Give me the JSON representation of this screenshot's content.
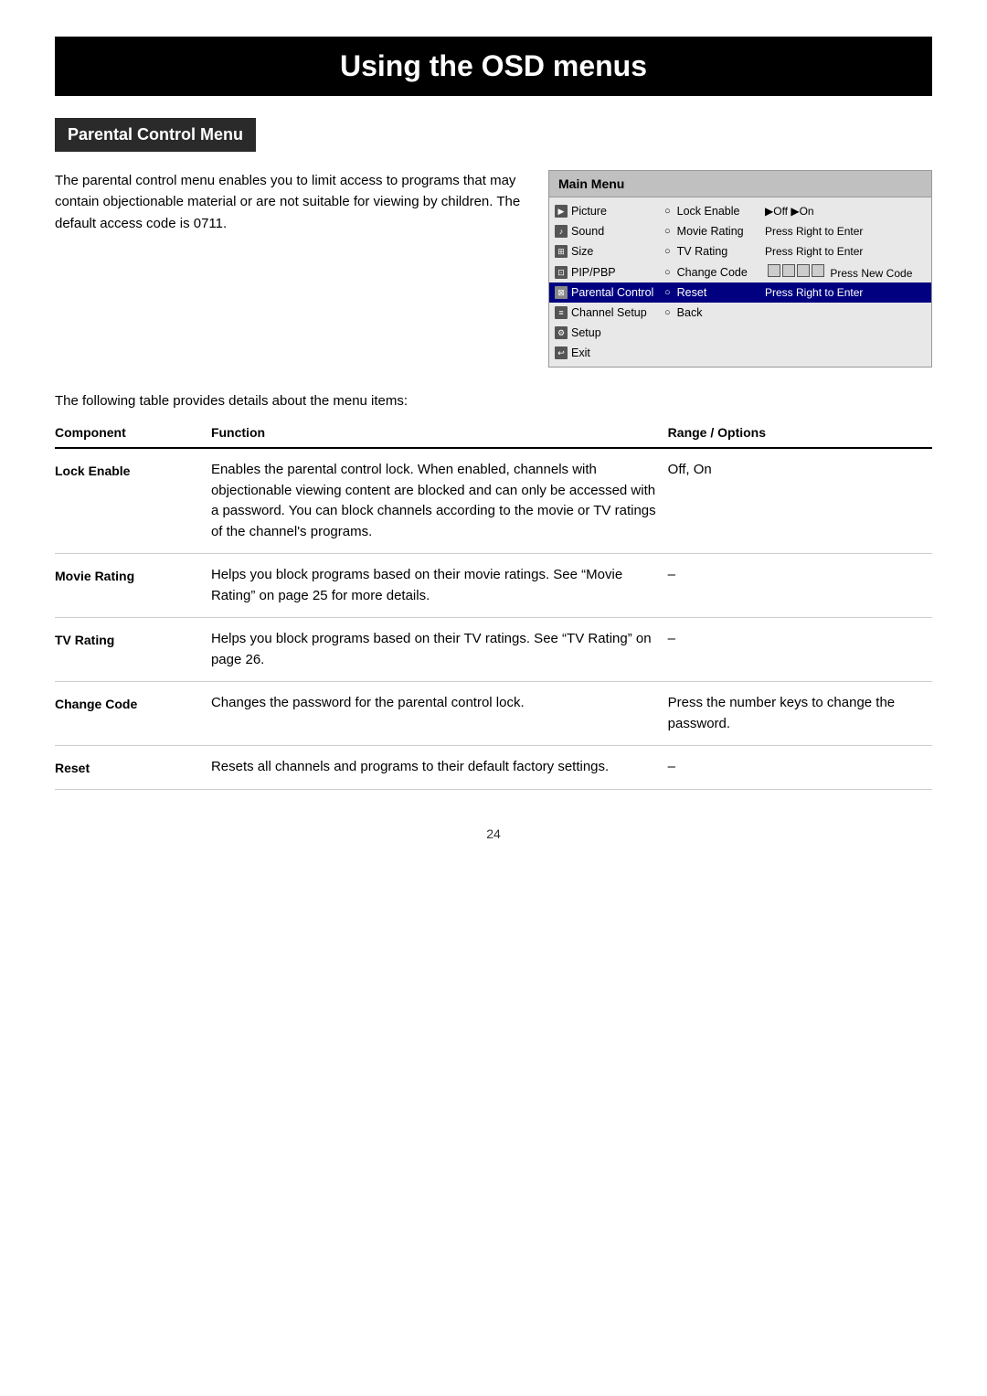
{
  "page": {
    "title": "Using the OSD menus",
    "section_heading": "Parental Control Menu",
    "intro_text": "The parental control menu enables you to limit access to programs that may contain objectionable material or are not suitable for viewing by children. The default access code is 0711.",
    "table_intro": "The following table provides details about the menu items:",
    "page_number": "24"
  },
  "osd": {
    "header": "Main Menu",
    "rows": [
      {
        "icon": "▶",
        "menu": "Picture",
        "bullet": "○",
        "option": "Lock Enable",
        "value": "▶Off  ▶On",
        "highlighted": false
      },
      {
        "icon": "♪",
        "menu": "Sound",
        "bullet": "○",
        "option": "Movie Rating",
        "value": "Press Right to Enter",
        "highlighted": false
      },
      {
        "icon": "⊞",
        "menu": "Size",
        "bullet": "○",
        "option": "TV Rating",
        "value": "Press Right to Enter",
        "highlighted": false
      },
      {
        "icon": "⊡",
        "menu": "PIP/PBP",
        "bullet": "○",
        "option": "Change Code",
        "value": "[  ][  ][  ][  ]  Press New Code",
        "highlighted": false
      },
      {
        "icon": "⊠",
        "menu": "Parental Control",
        "bullet": "○",
        "option": "Reset",
        "value": "Press Right to Enter",
        "highlighted": true
      },
      {
        "icon": "≡",
        "menu": "Channel Setup",
        "bullet": "○",
        "option": "Back",
        "value": "",
        "highlighted": false
      },
      {
        "icon": "⚙",
        "menu": "Setup",
        "bullet": "",
        "option": "",
        "value": "",
        "highlighted": false
      },
      {
        "icon": "↩",
        "menu": "Exit",
        "bullet": "",
        "option": "",
        "value": "",
        "highlighted": false
      }
    ]
  },
  "table": {
    "headers": [
      "Component",
      "Function",
      "Range / Options"
    ],
    "rows": [
      {
        "component": "Lock Enable",
        "function": "Enables the parental control lock. When enabled, channels with objectionable viewing content are blocked and can only be accessed with a password. You can block channels according to the movie or TV ratings of the channel's programs.",
        "range": "Off, On"
      },
      {
        "component": "Movie Rating",
        "function": "Helps you block programs based on their movie ratings. See “Movie Rating” on page 25 for more details.",
        "range": "–"
      },
      {
        "component": "TV Rating",
        "function": "Helps you block programs based on their TV ratings. See “TV Rating” on page 26.",
        "range": "–"
      },
      {
        "component": "Change Code",
        "function": "Changes the password for the parental control lock.",
        "range": "Press the number keys to change the password."
      },
      {
        "component": "Reset",
        "function": "Resets all channels and programs to their default factory settings.",
        "range": "–"
      }
    ]
  }
}
